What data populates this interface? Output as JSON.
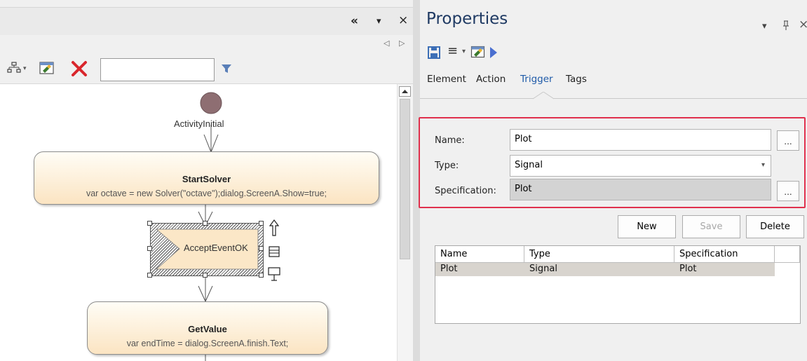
{
  "left_panel": {
    "title_controls": {
      "collapse": "«",
      "dropdown": "▾",
      "close": "×"
    },
    "tab_nav": {
      "prev": "◁",
      "next": "▷"
    },
    "toolbar": {
      "search_value": "",
      "dropdown": "▾"
    }
  },
  "diagram": {
    "initial_node_label": "ActivityInitial",
    "nodes": [
      {
        "name": "StartSolver",
        "code": "var octave = new Solver(\"octave\");dialog.ScreenA.Show=true;"
      },
      {
        "name": "AcceptEventOK"
      },
      {
        "name": "GetValue",
        "code": "var endTime = dialog.ScreenA.finish.Text;"
      }
    ]
  },
  "properties": {
    "title": "Properties",
    "title_controls": {
      "dropdown": "▾",
      "pin": "ᵖ",
      "close": "×"
    },
    "toolbar": {
      "menu": "≡",
      "dropdown": "▾"
    },
    "tabs": [
      {
        "label": "Element"
      },
      {
        "label": "Action"
      },
      {
        "label": "Trigger",
        "active": true
      },
      {
        "label": "Tags"
      }
    ],
    "form": {
      "name_label": "Name:",
      "name_value": "Plot",
      "type_label": "Type:",
      "type_value": "Signal",
      "spec_label": "Specification:",
      "spec_value": "Plot",
      "ellipsis": "..."
    },
    "buttons": {
      "new": "New",
      "save": "Save",
      "delete": "Delete"
    },
    "grid": {
      "columns": [
        "Name",
        "Type",
        "Specification"
      ],
      "rows": [
        {
          "name": "Plot",
          "type": "Signal",
          "spec": "Plot"
        }
      ]
    },
    "colors": {
      "title": "#1f3a63",
      "active_tab": "#1e5aa8",
      "highlight": "#e0304d",
      "selected_row": "#d8d4ce"
    }
  }
}
